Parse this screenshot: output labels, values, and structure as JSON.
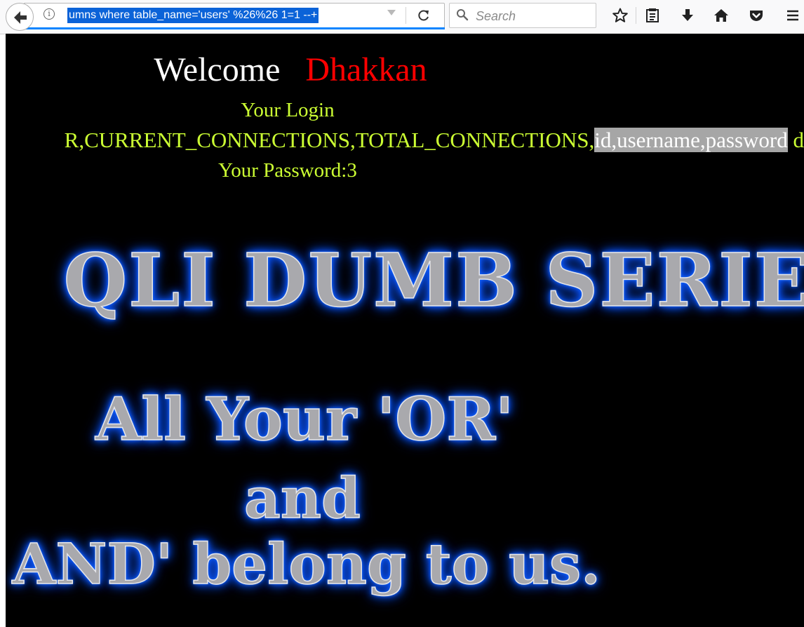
{
  "browser": {
    "url_text": "umns where table_name='users' %26%26 1=1 --+",
    "search_placeholder": "Search",
    "info_glyph": "i",
    "icons": [
      "back-arrow-icon",
      "info-icon",
      "dropdown-arrow-icon",
      "reload-icon",
      "search-icon",
      "star-icon",
      "reading-list-icon",
      "download-icon",
      "home-icon",
      "pocket-icon",
      "menu-icon"
    ]
  },
  "page": {
    "welcome_word": "Welcome",
    "username": "Dhakkan",
    "login_label": "Your Login",
    "login_values_pre": "R,CURRENT_CONNECTIONS,TOTAL_CONNECTIONS,",
    "login_values_selected": "id,username,password",
    "login_values_post": " d",
    "password_line": "Your Password:3",
    "banner_title": "QLI DUMB SERIE",
    "banner_line1": "All Your 'OR'",
    "banner_line2": "and",
    "banner_line3": "AND' belong to us."
  },
  "colors": {
    "page_background": "#000000",
    "welcome_text": "#ffffff",
    "username_text": "#ff0000",
    "login_text": "#ccff33",
    "selection_highlight": "#a6a6a6",
    "url_selection": "#0b63d8",
    "banner_glow": "#1a6cff"
  }
}
